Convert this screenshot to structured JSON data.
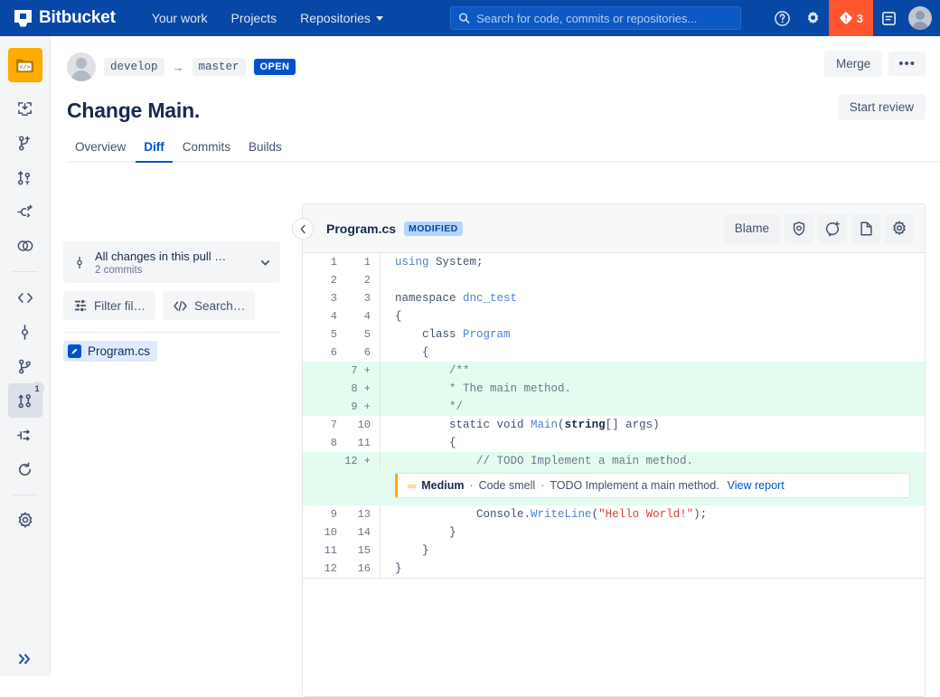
{
  "topnav": {
    "brand": "Bitbucket",
    "links": [
      {
        "label": "Your work",
        "icon": "none"
      },
      {
        "label": "Projects",
        "icon": "none"
      },
      {
        "label": "Repositories",
        "icon": "chevron-down-icon"
      }
    ],
    "search_placeholder": "Search for code, commits or repositories...",
    "help_icon": "help-circle-icon",
    "settings_icon": "gear-icon",
    "alert_icon": "warning-diamond-icon",
    "alert_count": "3",
    "notes_icon": "notes-icon",
    "avatar": "user-avatar"
  },
  "sidebar": {
    "items": [
      {
        "name": "repository",
        "icon": "repository-code-icon"
      },
      {
        "name": "clone",
        "icon": "clone-download-icon"
      },
      {
        "name": "create-branch",
        "icon": "branch-add-icon"
      },
      {
        "name": "create-pull-request",
        "icon": "pull-request-add-icon"
      },
      {
        "name": "create-fork",
        "icon": "fork-add-icon"
      },
      {
        "name": "compare",
        "icon": "compare-circles-icon"
      },
      {
        "name": "source",
        "icon": "code-brackets-icon"
      },
      {
        "name": "commits",
        "icon": "commit-icon"
      },
      {
        "name": "branches",
        "icon": "branches-icon"
      },
      {
        "name": "pull-requests",
        "icon": "pull-requests-icon",
        "badge": "1"
      },
      {
        "name": "pipelines",
        "icon": "pipeline-icon"
      },
      {
        "name": "deployments",
        "icon": "deployments-refresh-icon"
      },
      {
        "name": "repository-settings",
        "icon": "gear-icon"
      }
    ],
    "expand_icon": "double-chevron-right-icon"
  },
  "pr": {
    "source_branch": "develop",
    "arrow": "→",
    "target_branch": "master",
    "status": "OPEN",
    "title": "Change Main.",
    "merge_label": "Merge",
    "more_label": "•••",
    "start_review_label": "Start review",
    "tabs": [
      {
        "label": "Overview",
        "selected": false
      },
      {
        "label": "Diff",
        "selected": true
      },
      {
        "label": "Commits",
        "selected": false
      },
      {
        "label": "Builds",
        "selected": false
      }
    ]
  },
  "filters": {
    "changes_title": "All changes in this pull …",
    "changes_sub": "2 commits",
    "changes_icon": "commit-icon",
    "chevron_icon": "chevron-down-icon",
    "filter_label": "Filter fil…",
    "filter_icon": "filter-lines-icon",
    "search_label": "Search…",
    "search_icon": "code-brackets-icon",
    "files": [
      {
        "name": "Program.cs",
        "status_icon": "modified-pencil-icon"
      }
    ]
  },
  "diff": {
    "collapse_icon": "chevron-left-icon",
    "filename": "Program.cs",
    "status": "MODIFIED",
    "blame_label": "Blame",
    "tools": [
      {
        "name": "security-shield-icon"
      },
      {
        "name": "add-comment-icon"
      },
      {
        "name": "file-view-icon"
      },
      {
        "name": "diff-settings-gear-icon"
      }
    ],
    "lines": [
      {
        "old": "1",
        "new": "1",
        "type": "ctx",
        "tokens": [
          {
            "t": "using ",
            "c": "kw-blue"
          },
          {
            "t": "System;",
            "c": ""
          }
        ]
      },
      {
        "old": "2",
        "new": "2",
        "type": "ctx",
        "tokens": []
      },
      {
        "old": "3",
        "new": "3",
        "type": "ctx",
        "tokens": [
          {
            "t": "namespace ",
            "c": ""
          },
          {
            "t": "dnc_test",
            "c": "kw-blue"
          }
        ]
      },
      {
        "old": "4",
        "new": "4",
        "type": "ctx",
        "tokens": [
          {
            "t": "{",
            "c": ""
          }
        ]
      },
      {
        "old": "5",
        "new": "5",
        "type": "ctx",
        "tokens": [
          {
            "t": "    class ",
            "c": ""
          },
          {
            "t": "Program",
            "c": "kw-blue"
          }
        ]
      },
      {
        "old": "6",
        "new": "6",
        "type": "ctx",
        "tokens": [
          {
            "t": "    {",
            "c": ""
          }
        ]
      },
      {
        "old": "",
        "new": "7",
        "type": "add",
        "tokens": [
          {
            "t": "        /**",
            "c": "kw-cmt"
          }
        ]
      },
      {
        "old": "",
        "new": "8",
        "type": "add",
        "tokens": [
          {
            "t": "        * The main method.",
            "c": "kw-cmt"
          }
        ]
      },
      {
        "old": "",
        "new": "9",
        "type": "add",
        "tokens": [
          {
            "t": "        */",
            "c": "kw-cmt"
          }
        ]
      },
      {
        "old": "7",
        "new": "10",
        "type": "ctx",
        "tokens": [
          {
            "t": "        static void ",
            "c": ""
          },
          {
            "t": "Main",
            "c": "kw-blue"
          },
          {
            "t": "(",
            "c": ""
          },
          {
            "t": "string",
            "c": "kw-dark"
          },
          {
            "t": "[] args)",
            "c": ""
          }
        ]
      },
      {
        "old": "8",
        "new": "11",
        "type": "ctx",
        "tokens": [
          {
            "t": "        {",
            "c": ""
          }
        ]
      },
      {
        "old": "",
        "new": "12",
        "type": "add",
        "tokens": [
          {
            "t": "            // TODO Implement a main method.",
            "c": "kw-cmt"
          }
        ]
      }
    ],
    "annotation": {
      "severity_icon": "medium-severity-icon",
      "severity": "Medium",
      "sep1": "·",
      "category": "Code smell",
      "sep2": "·",
      "message": "TODO Implement a main method.",
      "link": "View report"
    },
    "lines_after": [
      {
        "old": "9",
        "new": "13",
        "type": "ctx",
        "tokens": [
          {
            "t": "            Console",
            "c": ""
          },
          {
            "t": ".",
            "c": ""
          },
          {
            "t": "WriteLine",
            "c": "kw-blue"
          },
          {
            "t": "(",
            "c": ""
          },
          {
            "t": "\"Hello World!\"",
            "c": "kw-str"
          },
          {
            "t": ");",
            "c": ""
          }
        ]
      },
      {
        "old": "10",
        "new": "14",
        "type": "ctx",
        "tokens": [
          {
            "t": "        }",
            "c": ""
          }
        ]
      },
      {
        "old": "11",
        "new": "15",
        "type": "ctx",
        "tokens": [
          {
            "t": "    }",
            "c": ""
          }
        ]
      },
      {
        "old": "12",
        "new": "16",
        "type": "ctx",
        "tokens": [
          {
            "t": "}",
            "c": ""
          }
        ]
      }
    ]
  },
  "colors": {
    "nav_bg": "#0747a6",
    "accent": "#0052cc",
    "added_bg": "#e3fcef",
    "alert_bg": "#ff5630",
    "repo_icon": "#ffab00",
    "warning": "#ffab00"
  }
}
